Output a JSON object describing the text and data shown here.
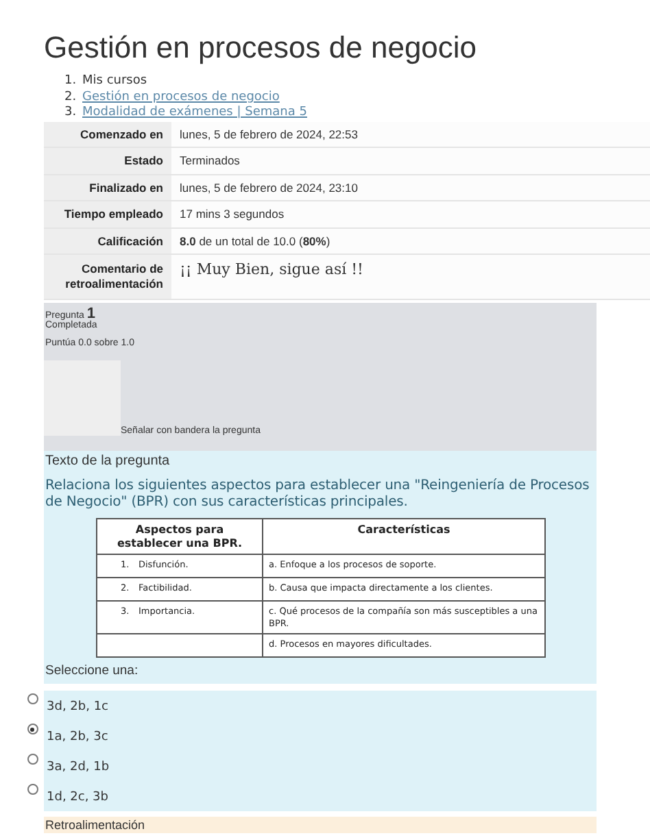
{
  "title": "Gestión en procesos de negocio",
  "breadcrumb": [
    {
      "number": "1.",
      "label": "Mis cursos",
      "link": false
    },
    {
      "number": "2.",
      "label": "Gestión en procesos de negocio",
      "link": true
    },
    {
      "number": "3.",
      "label": "Modalidad de exámenes | Semana 5",
      "link": true
    }
  ],
  "summary": [
    {
      "label": "Comenzado en",
      "value": "lunes, 5 de febrero de 2024, 22:53",
      "kind": "text"
    },
    {
      "label": "Estado",
      "value": "Terminados",
      "kind": "text"
    },
    {
      "label": "Finalizado en",
      "value": "lunes, 5 de febrero de 2024, 23:10",
      "kind": "text"
    },
    {
      "label": "Tiempo empleado",
      "value": "17 mins 3 segundos",
      "kind": "text"
    },
    {
      "label": "Calificación",
      "value": "**8.0** de un total de 10.0 (**80%**)",
      "kind": "text"
    },
    {
      "label": "Comentario de retroalimentación",
      "value": "¡¡ Muy Bien, sigue así !!",
      "kind": "feedback"
    }
  ],
  "question": {
    "label": "Pregunta",
    "number": "1",
    "status": "Completada",
    "score": "Puntúa 0.0 sobre 1.0",
    "flag": "Señalar con bandera la pregunta",
    "text_heading": "Texto de la pregunta",
    "prompt": "Relaciona los siguientes aspectos para establecer una \"Reingeniería de Procesos de Negocio\" (BPR) con sus características principales.",
    "table": {
      "columns": [
        "Aspectos para establecer una BPR.",
        "Características"
      ],
      "rows": [
        {
          "number": "1.",
          "aspect": "Disfunción.",
          "feature": "a. Enfoque a los procesos de soporte."
        },
        {
          "number": "2.",
          "aspect": "Factibilidad.",
          "feature": "b. Causa que impacta directamente a los clientes."
        },
        {
          "number": "3.",
          "aspect": "Importancia.",
          "feature": "c.  Qué procesos de la compañía son más susceptibles a una BPR."
        },
        {
          "feature": "d.  Procesos en mayores dificultades."
        }
      ]
    },
    "select_label": "Seleccione una:",
    "options": [
      {
        "label": "3d, 2b, 1c",
        "selected": false
      },
      {
        "label": "1a, 2b, 3c",
        "selected": true
      },
      {
        "label": "3a, 2d, 1b",
        "selected": false
      },
      {
        "label": "1d, 2c, 3b",
        "selected": false
      }
    ],
    "feedback_heading": "Retroalimentación"
  }
}
